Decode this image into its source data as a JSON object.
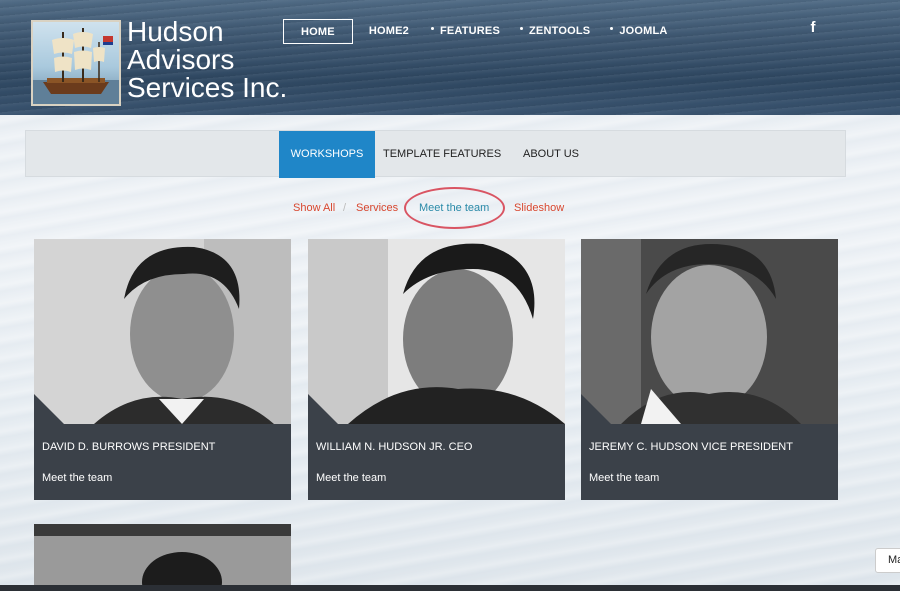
{
  "logo": {
    "lines": [
      "Hudson",
      "Advisors",
      "Services Inc."
    ]
  },
  "topnav": {
    "items": [
      {
        "label": "HOME",
        "active": true,
        "dot": false
      },
      {
        "label": "HOME2",
        "active": false,
        "dot": false
      },
      {
        "label": "FEATURES",
        "active": false,
        "dot": true
      },
      {
        "label": "ZENTOOLS",
        "active": false,
        "dot": true
      },
      {
        "label": "JOOMLA",
        "active": false,
        "dot": true
      }
    ],
    "social_icon": "f"
  },
  "subnav": {
    "tabs": [
      {
        "label": "WORKSHOPS",
        "active": true
      },
      {
        "label": "TEMPLATE FEATURES",
        "active": false
      },
      {
        "label": "ABOUT US",
        "active": false
      }
    ]
  },
  "filters": {
    "items": [
      {
        "label": "Show All",
        "active": false
      },
      {
        "label": "Services",
        "active": false
      },
      {
        "label": "Meet the team",
        "active": true
      },
      {
        "label": "Slideshow",
        "active": false
      }
    ],
    "separator": "/"
  },
  "team": [
    {
      "title": "DAVID D. BURROWS PRESIDENT",
      "link": "Meet the team"
    },
    {
      "title": "WILLIAM N. HUDSON JR. CEO",
      "link": "Meet the team"
    },
    {
      "title": "JEREMY C. HUDSON VICE PRESIDENT",
      "link": "Meet the team"
    }
  ],
  "corner_tab": {
    "label": "Ma"
  },
  "colors": {
    "accent": "#1f86c8",
    "filter": "#d8472f",
    "filter_active": "#2a8aa8",
    "card": "#3b4149",
    "highlight_circle": "#d95563"
  }
}
